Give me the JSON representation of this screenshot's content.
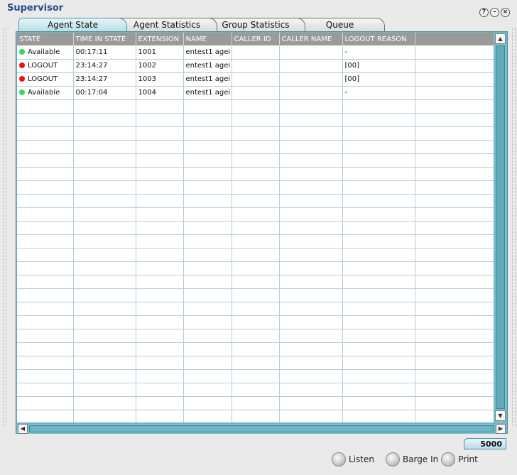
{
  "window": {
    "title": "Supervisor",
    "buttons": [
      {
        "name": "help-icon",
        "glyph": "?"
      },
      {
        "name": "minimize-icon",
        "glyph": "–"
      },
      {
        "name": "close-icon",
        "glyph": "×"
      }
    ]
  },
  "tabs": [
    {
      "label": "Agent State",
      "active": true
    },
    {
      "label": "Agent Statistics",
      "active": false
    },
    {
      "label": "Group Statistics",
      "active": false
    },
    {
      "label": "Queue",
      "active": false
    }
  ],
  "table": {
    "columns": [
      "STATE",
      "TIME IN STATE",
      "EXTENSION",
      "NAME",
      "CALLER ID",
      "CALLER NAME",
      "LOGOUT REASON",
      ""
    ],
    "rows": [
      {
        "state": "Available",
        "status_color": "#33dd55",
        "time": "00:17:11",
        "extension": "1001",
        "name": "entest1 agei",
        "caller_id": "",
        "caller_name": "",
        "logout_reason": "-"
      },
      {
        "state": "LOGOUT",
        "status_color": "#ee1111",
        "time": "23:14:27",
        "extension": "1002",
        "name": "entest1 agei",
        "caller_id": "",
        "caller_name": "",
        "logout_reason": "[00]"
      },
      {
        "state": "LOGOUT",
        "status_color": "#ee1111",
        "time": "23:14:27",
        "extension": "1003",
        "name": "entest1 agei",
        "caller_id": "",
        "caller_name": "",
        "logout_reason": "[00]"
      },
      {
        "state": "Available",
        "status_color": "#33dd55",
        "time": "00:17:04",
        "extension": "1004",
        "name": "entest1 agei",
        "caller_id": "",
        "caller_name": "",
        "logout_reason": "-"
      }
    ]
  },
  "extension_badge": "5000",
  "actions": {
    "listen": "Listen",
    "barge_in": "Barge In",
    "print": "Print"
  }
}
